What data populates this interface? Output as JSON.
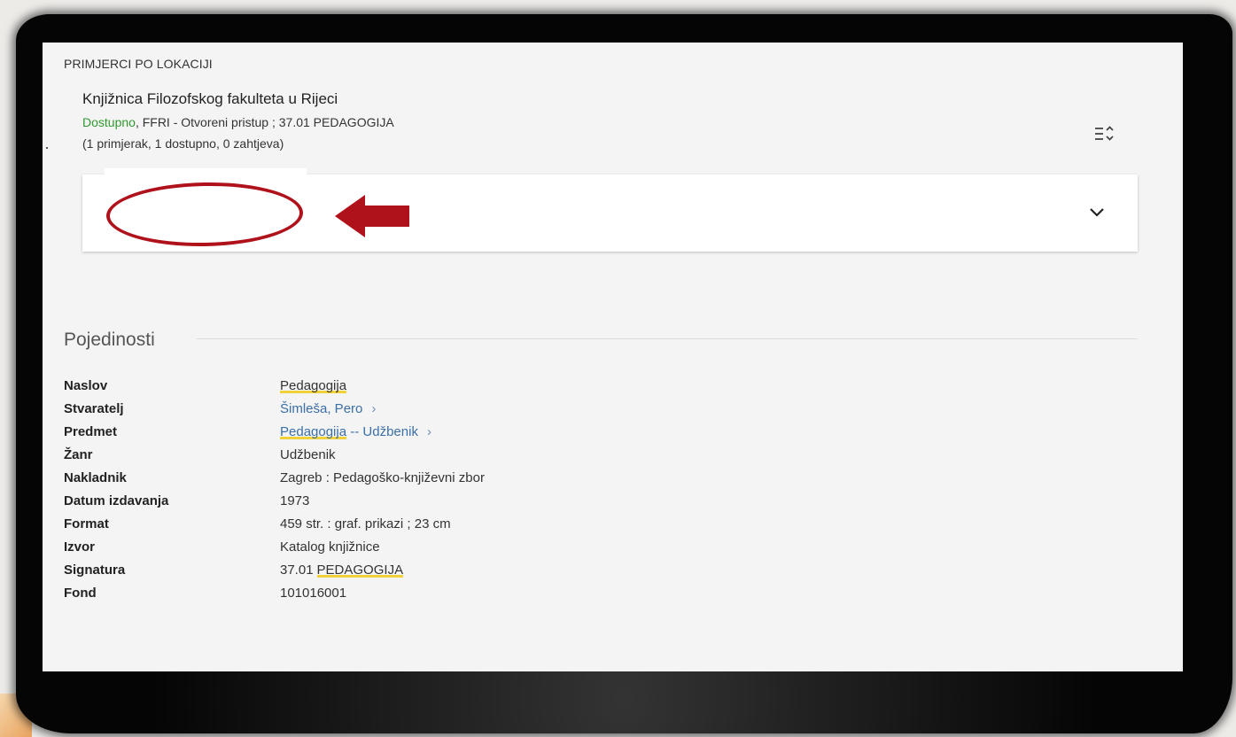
{
  "locations": {
    "section_heading": "PRIMJERCI PO LOKACIJI",
    "library_name": "Knjižnica Filozofskog fakulteta u Rijeci",
    "availability_status": "Dostupno",
    "location_detail": ", FFRI - Otvoreni pristup ; 37.01 PEDAGOGIJA",
    "copies_summary": "(1 primjerak, 1 dostupno, 0 zahtjeva)"
  },
  "details": {
    "heading": "Pojedinosti",
    "rows": [
      {
        "label": "Naslov",
        "value": "Pedagogija"
      },
      {
        "label": "Stvaratelj",
        "value": "Šimleša, Pero"
      },
      {
        "label": "Predmet",
        "value_part1": "Pedagogija",
        "value_part2": "-- Udžbenik"
      },
      {
        "label": "Žanr",
        "value": "Udžbenik"
      },
      {
        "label": "Nakladnik",
        "value": "Zagreb : Pedagoško-književni zbor"
      },
      {
        "label": "Datum izdavanja",
        "value": "1973"
      },
      {
        "label": "Format",
        "value": "459 str. : graf. prikazi ; 23 cm"
      },
      {
        "label": "Izvor",
        "value": "Katalog knjižnice"
      },
      {
        "label": "Signatura",
        "value_part1": "37.01",
        "value_part2": "PEDAGOGIJA"
      },
      {
        "label": "Fond",
        "value": "101016001"
      }
    ]
  },
  "icons": {
    "sort": "sort-options-icon",
    "expand": "chevron-down-icon",
    "link_arrow": "chevron-right-icon"
  },
  "colors": {
    "available": "#2f9a2f",
    "link": "#3b6fa8",
    "highlight": "#f2d23a",
    "annotation": "#b0121b"
  }
}
